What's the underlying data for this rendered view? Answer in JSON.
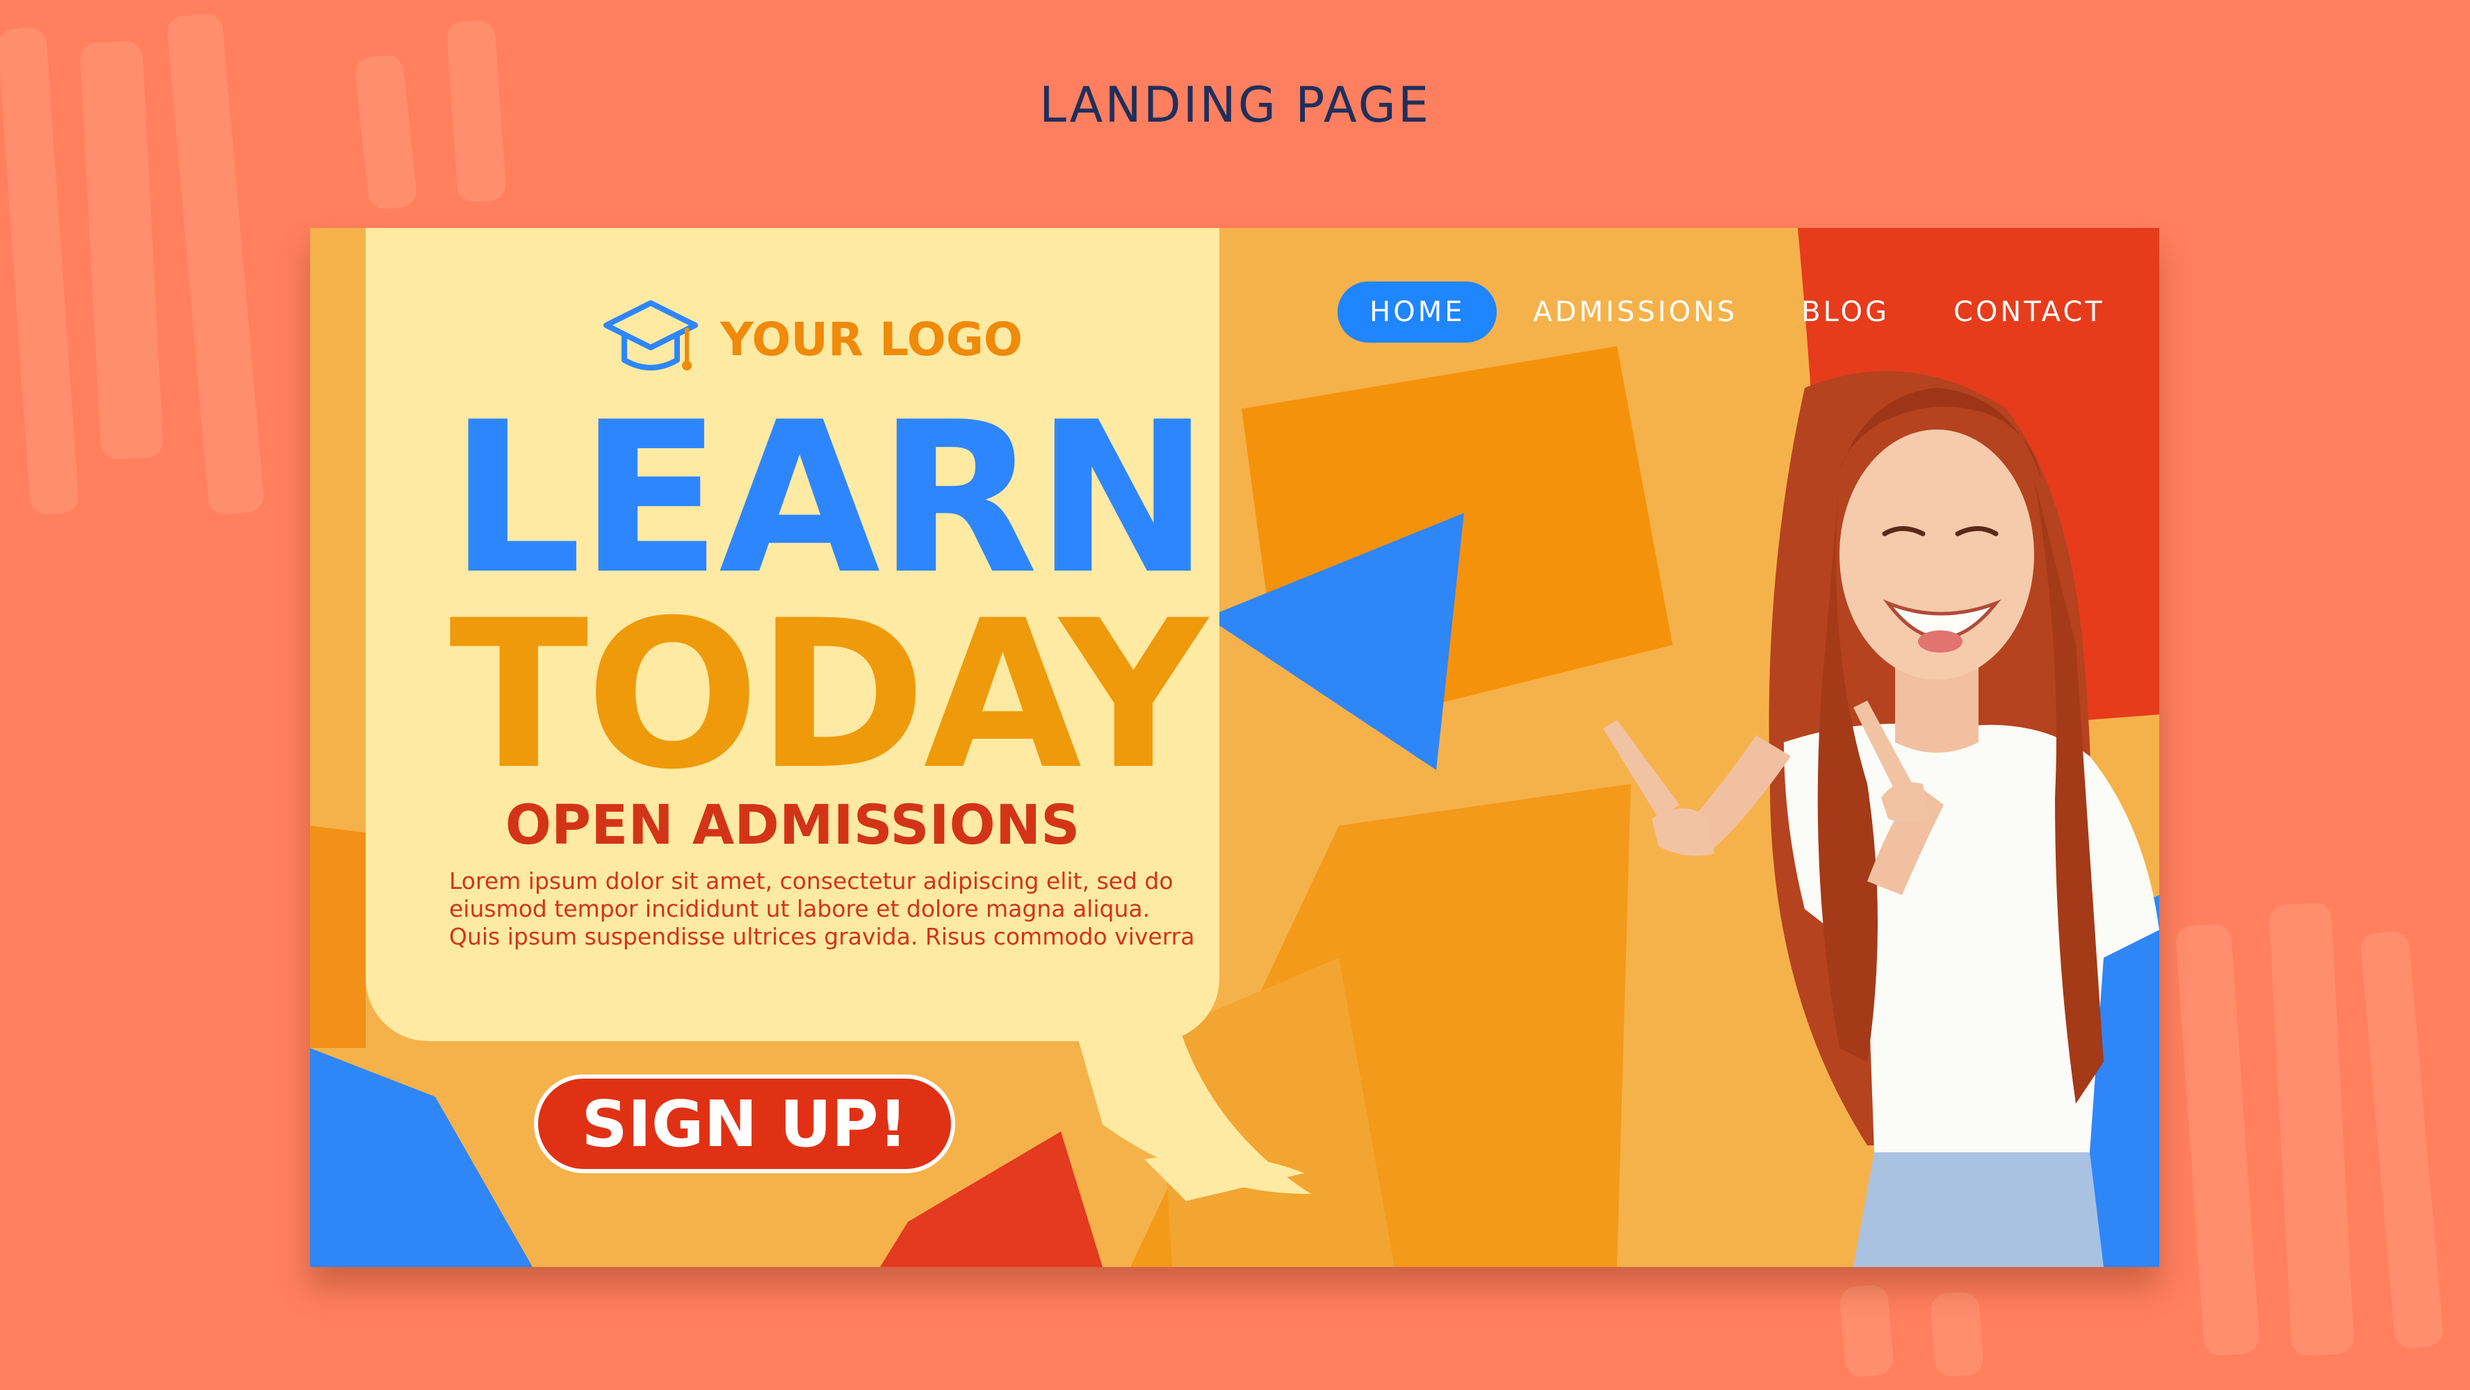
{
  "page_heading": "LANDING PAGE",
  "logo": {
    "icon": "graduation-cap-icon",
    "text": "YOUR LOGO"
  },
  "nav": {
    "items": [
      {
        "label": "HOME",
        "active": true
      },
      {
        "label": "ADMISSIONS",
        "active": false
      },
      {
        "label": "BLOG",
        "active": false
      },
      {
        "label": "CONTACT",
        "active": false
      }
    ]
  },
  "hero": {
    "title_line1": "LEARN",
    "title_line2": "TODAY",
    "subtitle": "OPEN ADMISSIONS",
    "body_lines": [
      "Lorem ipsum dolor sit amet, consectetur adipiscing elit, sed do",
      "eiusmod tempor incididunt ut labore et dolore magna aliqua.",
      "Quis ipsum suspendisse ultrices gravida. Risus commodo viverra"
    ],
    "cta_label": "SIGN UP!"
  },
  "colors": {
    "background": "#ff7f5f",
    "frame": "#f6b24a",
    "bubble": "#ffeaa3",
    "blue_accent": "#2e86ff",
    "orange_accent": "#ef9a0b",
    "red_accent": "#d33418",
    "heading_navy": "#1f2f5c"
  }
}
